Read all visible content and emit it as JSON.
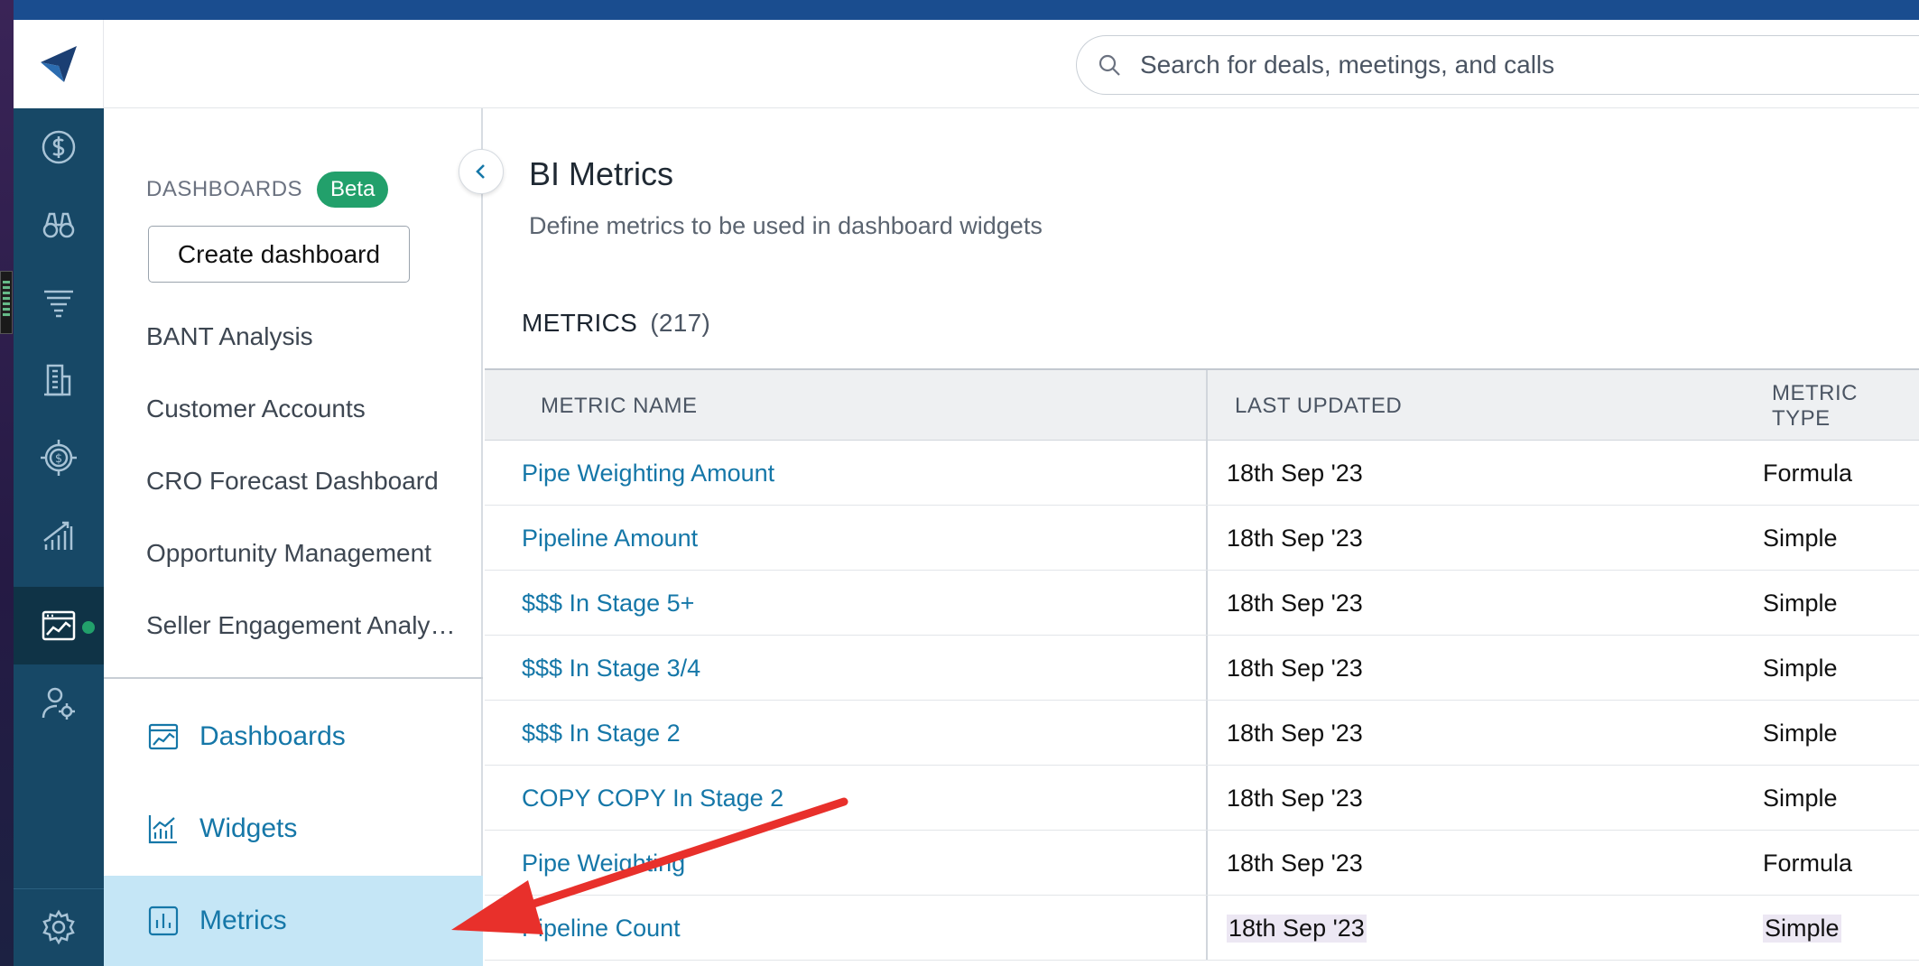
{
  "colors": {
    "rail": "#174866",
    "accent": "#1577a8",
    "beta": "#22a06b",
    "active_nav": "#c5e6f6",
    "arrow": "#e8302b"
  },
  "search": {
    "placeholder": "Search for deals, meetings, and calls"
  },
  "rail": {
    "icons": [
      "logo-icon",
      "dollar-icon",
      "binoculars-icon",
      "funnel-icon",
      "building-icon",
      "target-dollar-icon",
      "chart-growth-icon",
      "dashboard-icon",
      "user-settings-icon",
      "gear-icon"
    ]
  },
  "sidebar": {
    "section_title": "DASHBOARDS",
    "badge": "Beta",
    "create_label": "Create dashboard",
    "dashboards": [
      "BANT Analysis",
      "Customer Accounts",
      "CRO Forecast Dashboard",
      "Opportunity Management",
      "Seller Engagement Analysis"
    ],
    "nav": [
      {
        "label": "Dashboards",
        "icon": "dashboard-icon"
      },
      {
        "label": "Widgets",
        "icon": "chart-icon"
      },
      {
        "label": "Metrics",
        "icon": "metrics-icon"
      }
    ]
  },
  "main": {
    "title": "BI Metrics",
    "subtitle": "Define metrics to be used in dashboard widgets",
    "metrics_label": "METRICS",
    "metrics_count": "(217)",
    "columns": [
      "METRIC NAME",
      "LAST UPDATED",
      "METRIC TYPE"
    ],
    "rows": [
      {
        "name": "Pipe Weighting Amount",
        "date": "18th Sep '23",
        "type": "Formula"
      },
      {
        "name": "Pipeline Amount",
        "date": "18th Sep '23",
        "type": "Simple"
      },
      {
        "name": "$$$ In Stage 5+",
        "date": "18th Sep '23",
        "type": "Simple"
      },
      {
        "name": "$$$ In Stage 3/4",
        "date": "18th Sep '23",
        "type": "Simple"
      },
      {
        "name": "$$$ In Stage 2",
        "date": "18th Sep '23",
        "type": "Simple"
      },
      {
        "name": "COPY COPY In Stage 2",
        "date": "18th Sep '23",
        "type": "Simple"
      },
      {
        "name": "Pipe Weighting",
        "date": "18th Sep '23",
        "type": "Formula"
      },
      {
        "name": "Pipeline Count",
        "date": "18th Sep '23",
        "type": "Simple"
      }
    ]
  }
}
